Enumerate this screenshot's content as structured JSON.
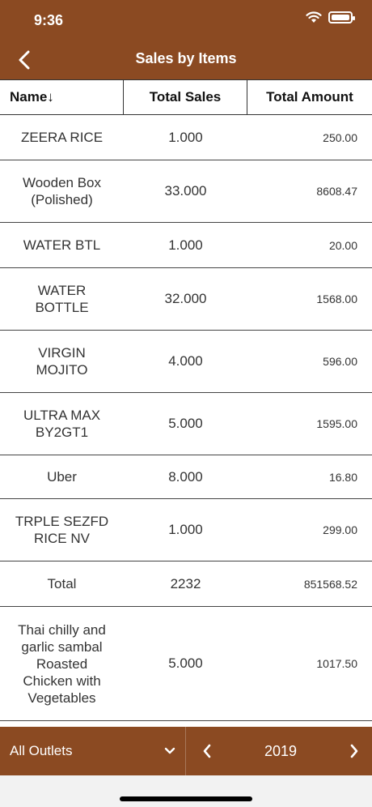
{
  "status": {
    "time": "9:36"
  },
  "header": {
    "title": "Sales by Items"
  },
  "table": {
    "columns": [
      "Name↓",
      "Total Sales",
      "Total Amount"
    ],
    "rows": [
      {
        "name": "ZEERA RICE",
        "sales": "1.000",
        "amount": "250.00"
      },
      {
        "name": "Wooden Box\n(Polished)",
        "sales": "33.000",
        "amount": "8608.47"
      },
      {
        "name": "WATER BTL",
        "sales": "1.000",
        "amount": "20.00"
      },
      {
        "name": "WATER\nBOTTLE",
        "sales": "32.000",
        "amount": "1568.00"
      },
      {
        "name": "VIRGIN\nMOJITO",
        "sales": "4.000",
        "amount": "596.00"
      },
      {
        "name": "ULTRA MAX\nBY2GT1",
        "sales": "5.000",
        "amount": "1595.00"
      },
      {
        "name": "Uber",
        "sales": "8.000",
        "amount": "16.80"
      },
      {
        "name": "TRPLE SEZFD\nRICE NV",
        "sales": "1.000",
        "amount": "299.00"
      },
      {
        "name": "Total",
        "sales": "2232",
        "amount": "851568.52"
      },
      {
        "name": "Thai chilly and\ngarlic sambal\nRoasted\nChicken with\nVegetables",
        "sales": "5.000",
        "amount": "1017.50"
      }
    ]
  },
  "footer": {
    "outlet_label": "All Outlets",
    "year": "2019"
  },
  "colors": {
    "brand": "#8b4a22"
  }
}
